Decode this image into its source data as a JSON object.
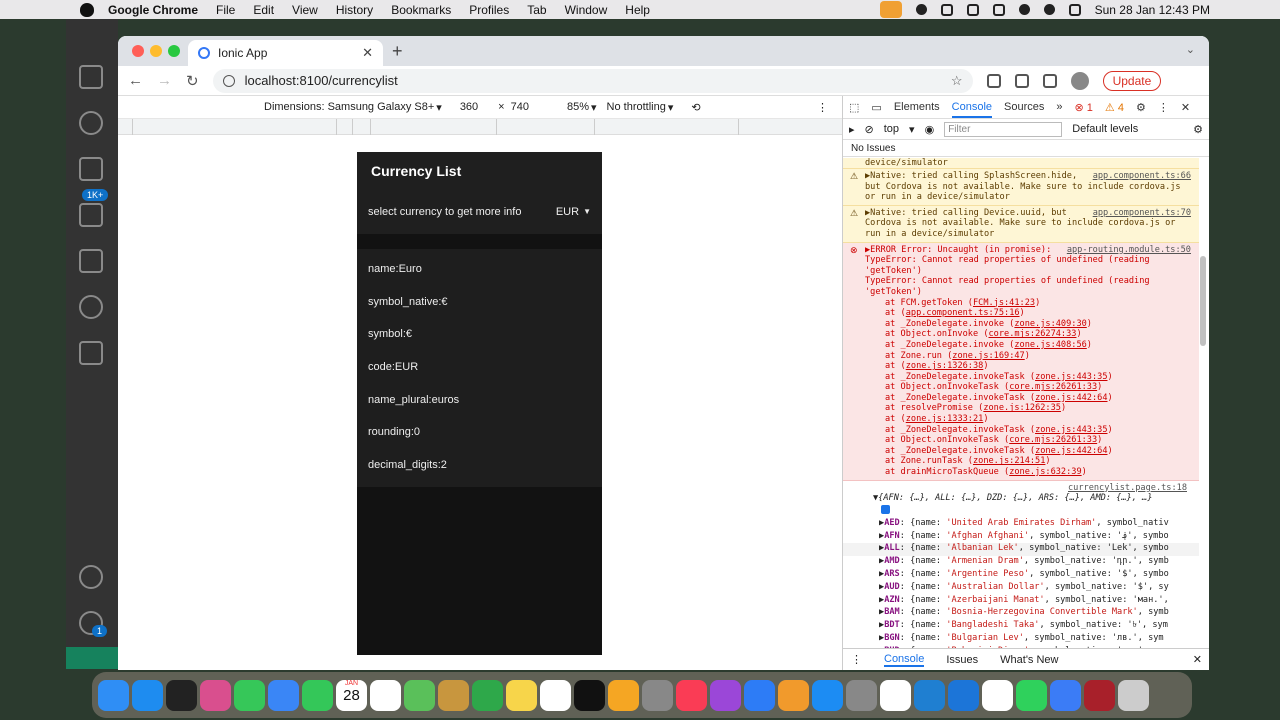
{
  "menubar": {
    "app": "Google Chrome",
    "items": [
      "File",
      "Edit",
      "View",
      "History",
      "Bookmarks",
      "Profiles",
      "Tab",
      "Window",
      "Help"
    ],
    "clock": "Sun 28 Jan  12:43 PM"
  },
  "vscode": {
    "badge": "1K+",
    "settings_badge": "1"
  },
  "browser": {
    "tab_title": "Ionic App",
    "url": "localhost:8100/currencylist",
    "update_label": "Update"
  },
  "device_toolbar": {
    "dimensions": "Dimensions: Samsung Galaxy S8+",
    "width": "360",
    "times": "×",
    "height": "740",
    "zoom": "85%",
    "throttling": "No throttling"
  },
  "app": {
    "title": "Currency List",
    "select_prompt": "select currency to get more info",
    "selected_currency": "EUR",
    "details": [
      "name:Euro",
      "symbol_native:€",
      "symbol:€",
      "code:EUR",
      "name_plural:euros",
      "rounding:0",
      "decimal_digits:2"
    ]
  },
  "devtools": {
    "tabs": [
      "Elements",
      "Console",
      "Sources"
    ],
    "error_count": "1",
    "warning_count": "4",
    "context": "top",
    "filter_placeholder": "Filter",
    "levels": "Default levels",
    "issues": "No Issues",
    "truncated_top": "device/simulator",
    "warnings": [
      {
        "text": "▶Native: tried calling SplashScreen.hide, but Cordova is not available. Make sure to include cordova.js or run in a device/simulator",
        "src": "app.component.ts:66"
      },
      {
        "text": "▶Native: tried calling Device.uuid, but Cordova is not available. Make sure to include cordova.js or run in a device/simulator",
        "src": "app.component.ts:70"
      }
    ],
    "error": {
      "head": "▶ERROR Error: Uncaught (in promise): TypeError: Cannot read properties of undefined (reading 'getToken')",
      "type": "TypeError: Cannot read properties of undefined (reading 'getToken')",
      "src": "app-routing.module.ts:50",
      "stack": [
        {
          "fn": "at FCM.getToken",
          "loc": "FCM.js:41:23"
        },
        {
          "fn": "at",
          "loc": "app.component.ts:75:16"
        },
        {
          "fn": "at _ZoneDelegate.invoke",
          "loc": "zone.js:409:30"
        },
        {
          "fn": "at Object.onInvoke",
          "loc": "core.mjs:26274:33"
        },
        {
          "fn": "at _ZoneDelegate.invoke",
          "loc": "zone.js:408:56"
        },
        {
          "fn": "at Zone.run",
          "loc": "zone.js:169:47"
        },
        {
          "fn": "at",
          "loc": "zone.js:1326:38"
        },
        {
          "fn": "at _ZoneDelegate.invokeTask",
          "loc": "zone.js:443:35"
        },
        {
          "fn": "at Object.onInvokeTask",
          "loc": "core.mjs:26261:33"
        },
        {
          "fn": "at _ZoneDelegate.invokeTask",
          "loc": "zone.js:442:64"
        },
        {
          "fn": "at resolvePromise",
          "loc": "zone.js:1262:35"
        },
        {
          "fn": "at",
          "loc": "zone.js:1333:21"
        },
        {
          "fn": "at _ZoneDelegate.invokeTask",
          "loc": "zone.js:443:35"
        },
        {
          "fn": "at Object.onInvokeTask",
          "loc": "core.mjs:26261:33"
        },
        {
          "fn": "at _ZoneDelegate.invokeTask",
          "loc": "zone.js:442:64"
        },
        {
          "fn": "at Zone.runTask",
          "loc": "zone.js:214:51"
        },
        {
          "fn": "at drainMicroTaskQueue",
          "loc": "zone.js:632:39"
        }
      ]
    },
    "log": {
      "src": "currencylist.page.ts:18",
      "summary": "▼{AFN: {…}, ALL: {…}, DZD: {…}, ARS: {…}, AMD: {…}, …}",
      "rows": [
        {
          "key": "AED",
          "name": "'United Arab Emirates Dirham'",
          "rest": ", symbol_nativ"
        },
        {
          "key": "AFN",
          "name": "'Afghan Afghani'",
          "rest": ", symbol_native: '؋', symbo"
        },
        {
          "key": "ALL",
          "name": "'Albanian Lek'",
          "rest": ", symbol_native: 'Lek', symbo"
        },
        {
          "key": "AMD",
          "name": "'Armenian Dram'",
          "rest": ", symbol_native: 'դր.', symb"
        },
        {
          "key": "ARS",
          "name": "'Argentine Peso'",
          "rest": ", symbol_native: '$', symbo"
        },
        {
          "key": "AUD",
          "name": "'Australian Dollar'",
          "rest": ", symbol_native: '$', sy"
        },
        {
          "key": "AZN",
          "name": "'Azerbaijani Manat'",
          "rest": ", symbol_native: 'ман.', "
        },
        {
          "key": "BAM",
          "name": "'Bosnia-Herzegovina Convertible Mark'",
          "rest": ", symb"
        },
        {
          "key": "BDT",
          "name": "'Bangladeshi Taka'",
          "rest": ", symbol_native: '৳', sym"
        },
        {
          "key": "BGN",
          "name": "'Bulgarian Lev'",
          "rest": ", symbol_native: 'лв.', sym"
        },
        {
          "key": "BHD",
          "name": "'Bahraini Dinar'",
          "rest": ", symbol_native: '...', sym"
        }
      ]
    },
    "bottom_tabs": [
      "Console",
      "Issues",
      "What's New"
    ]
  },
  "dock": {
    "calendar_month": "JAN",
    "calendar_day": "28",
    "apps": [
      "finder",
      "safari",
      "terminal",
      "launchpad",
      "messages",
      "mail",
      "facetime",
      "calendar",
      "reminders",
      "maps",
      "contacts",
      "numbers",
      "notes",
      "freeform",
      "apple-tv",
      "photos",
      "screenshot",
      "music",
      "podcasts",
      "keynote",
      "pages",
      "app-store",
      "system-settings",
      "chrome",
      "vscode",
      "xcode",
      "teamviewer",
      "whatsapp",
      "messenger",
      "dictionary",
      "trash"
    ]
  }
}
